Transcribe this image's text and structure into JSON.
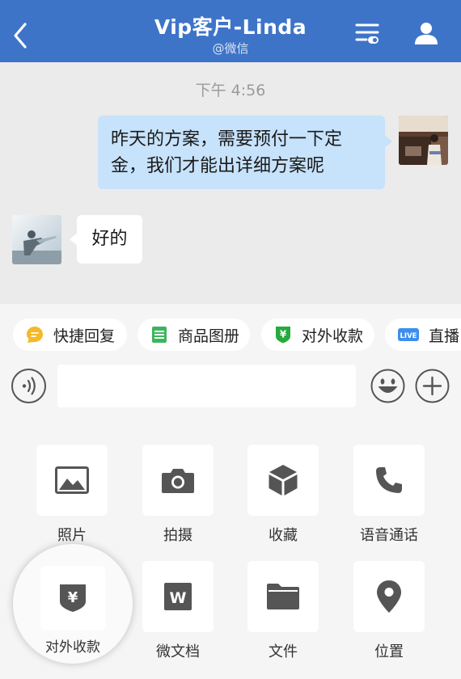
{
  "header": {
    "title": "Vip客户-Linda",
    "subtitle": "@微信",
    "icons": [
      "back-icon",
      "chat-settings-icon",
      "user-profile-icon"
    ]
  },
  "chat": {
    "timestamp": "下午 4:56",
    "messages": [
      {
        "from": "self",
        "text": "昨天的方案，需要预付一下定金，我们才能出详细方案呢"
      },
      {
        "from": "other",
        "text": "好的"
      }
    ]
  },
  "quick_replies": [
    {
      "label": "快捷回复",
      "icon": "quick-reply-icon",
      "color": "#f5b829"
    },
    {
      "label": "商品图册",
      "icon": "product-album-icon",
      "color": "#3cb65c"
    },
    {
      "label": "对外收款",
      "icon": "payment-shield-icon",
      "color": "#26a93e"
    },
    {
      "label": "直播",
      "icon": "live-icon",
      "color": "#3d8ef0"
    }
  ],
  "input": {
    "value": "",
    "placeholder": ""
  },
  "actions": [
    {
      "label": "照片",
      "icon": "photo-icon"
    },
    {
      "label": "拍摄",
      "icon": "camera-icon"
    },
    {
      "label": "收藏",
      "icon": "favorites-icon"
    },
    {
      "label": "语音通话",
      "icon": "phone-icon"
    },
    {
      "label": "对外收款",
      "icon": "payment-shield-icon"
    },
    {
      "label": "微文档",
      "icon": "doc-icon"
    },
    {
      "label": "文件",
      "icon": "folder-icon"
    },
    {
      "label": "位置",
      "icon": "location-icon"
    }
  ],
  "colors": {
    "header_bg": "#3e74c8",
    "outgoing_bubble": "#c7e2fb",
    "chat_bg": "#ebebeb",
    "panel_bg": "#f5f5f5"
  }
}
